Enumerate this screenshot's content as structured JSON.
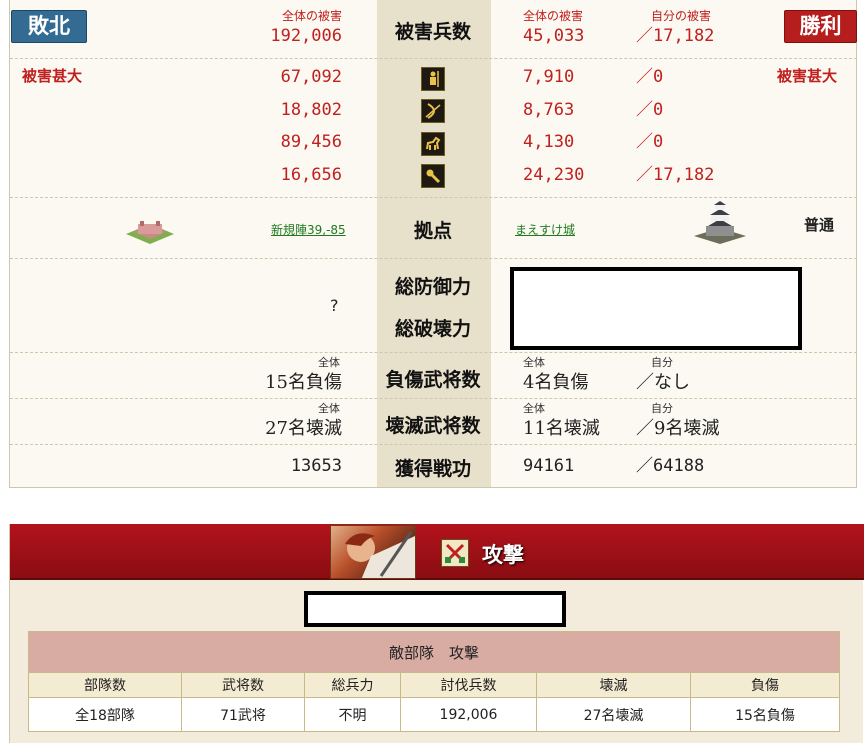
{
  "report": {
    "lose_label": "敗北",
    "win_label": "勝利",
    "left_heavy": "被害甚大",
    "right_heavy": "被害甚大",
    "left_total_label": "全体の被害",
    "left_total": "192,006",
    "center_title": "被害兵数",
    "right_total_label": "全体の被害",
    "right_total": "45,033",
    "right_own_label": "自分の被害",
    "right_own": "／17,182",
    "units": [
      {
        "icon": "spearman-icon",
        "left": "67,092",
        "right": "7,910",
        "own": "／0"
      },
      {
        "icon": "archer-icon",
        "left": "18,802",
        "right": "8,763",
        "own": "／0"
      },
      {
        "icon": "cavalry-icon",
        "left": "89,456",
        "right": "4,130",
        "own": "／0"
      },
      {
        "icon": "siege-icon",
        "left": "16,656",
        "right": "24,230",
        "own": "／17,182"
      }
    ],
    "base": {
      "title": "拠点",
      "left_link": "新規陣39,-85",
      "right_link": "まえすけ城",
      "difficulty": "普通"
    },
    "defense": {
      "title_def": "総防御力",
      "title_break": "総破壊力",
      "left_value": "?"
    },
    "wounded": {
      "title": "負傷武将数",
      "left_label": "全体",
      "left_value": "15名負傷",
      "right_label": "全体",
      "right_value": "4名負傷",
      "own_label": "自分",
      "own_value": "／なし"
    },
    "destroyed": {
      "title": "壊滅武将数",
      "left_label": "全体",
      "left_value": "27名壊滅",
      "right_label": "全体",
      "right_value": "11名壊滅",
      "own_label": "自分",
      "own_value": "／9名壊滅"
    },
    "merit": {
      "title": "獲得戦功",
      "left_value": "13653",
      "right_value": "94161",
      "own_value": "／64188"
    }
  },
  "attack": {
    "title": "攻撃",
    "table_caption": "敵部隊　攻撃",
    "headers": [
      "部隊数",
      "武将数",
      "総兵力",
      "討伐兵数",
      "壊滅",
      "負傷"
    ],
    "values": [
      "全18部隊",
      "71武将",
      "不明",
      "192,006",
      "27名壊滅",
      "15名負傷"
    ]
  },
  "colors": {
    "lose": "#336b92",
    "win": "#b61d1d",
    "damage_red": "#c0201f",
    "banner_red": "#a3101a",
    "link_green": "#1f7a1f"
  }
}
